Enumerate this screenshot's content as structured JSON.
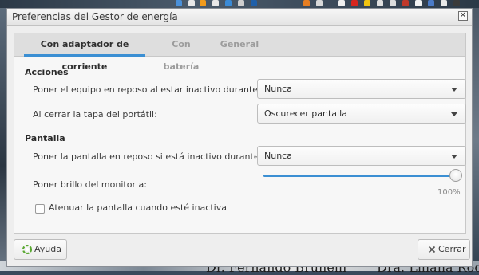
{
  "window": {
    "title": "Preferencias del Gestor de energía",
    "close_glyph": "✕"
  },
  "tabs": [
    {
      "label": "Con adaptador de corriente",
      "active": true
    },
    {
      "label": "Con batería",
      "active": false
    },
    {
      "label": "General",
      "active": false
    }
  ],
  "actions": {
    "heading": "Acciones",
    "sleep_label": "Poner el equipo en reposo al estar inactivo durante:",
    "sleep_value": "Nunca",
    "lid_label": "Al cerrar la tapa del portátil:",
    "lid_value": "Oscurecer pantalla"
  },
  "screen": {
    "heading": "Pantalla",
    "sleep_label": "Poner la pantalla en reposo si está inactivo durante:",
    "sleep_value": "Nunca",
    "brightness_label": "Poner brillo del monitor a:",
    "brightness_value": "100%",
    "brightness_fraction": 1.0,
    "dim_label": "Atenuar la pantalla cuando esté inactiva",
    "dim_checked": false
  },
  "buttons": {
    "help": "Ayuda",
    "close": "Cerrar"
  },
  "icons": {
    "help": "help-lifebuoy-icon",
    "close": "close-x-icon"
  },
  "background_text": {
    "left": "Dr. Fernando Brunelli",
    "right": "Dra. Liliana Roc"
  },
  "colors": {
    "accent": "#3b8fd3",
    "help_icon": "#5aa832"
  }
}
